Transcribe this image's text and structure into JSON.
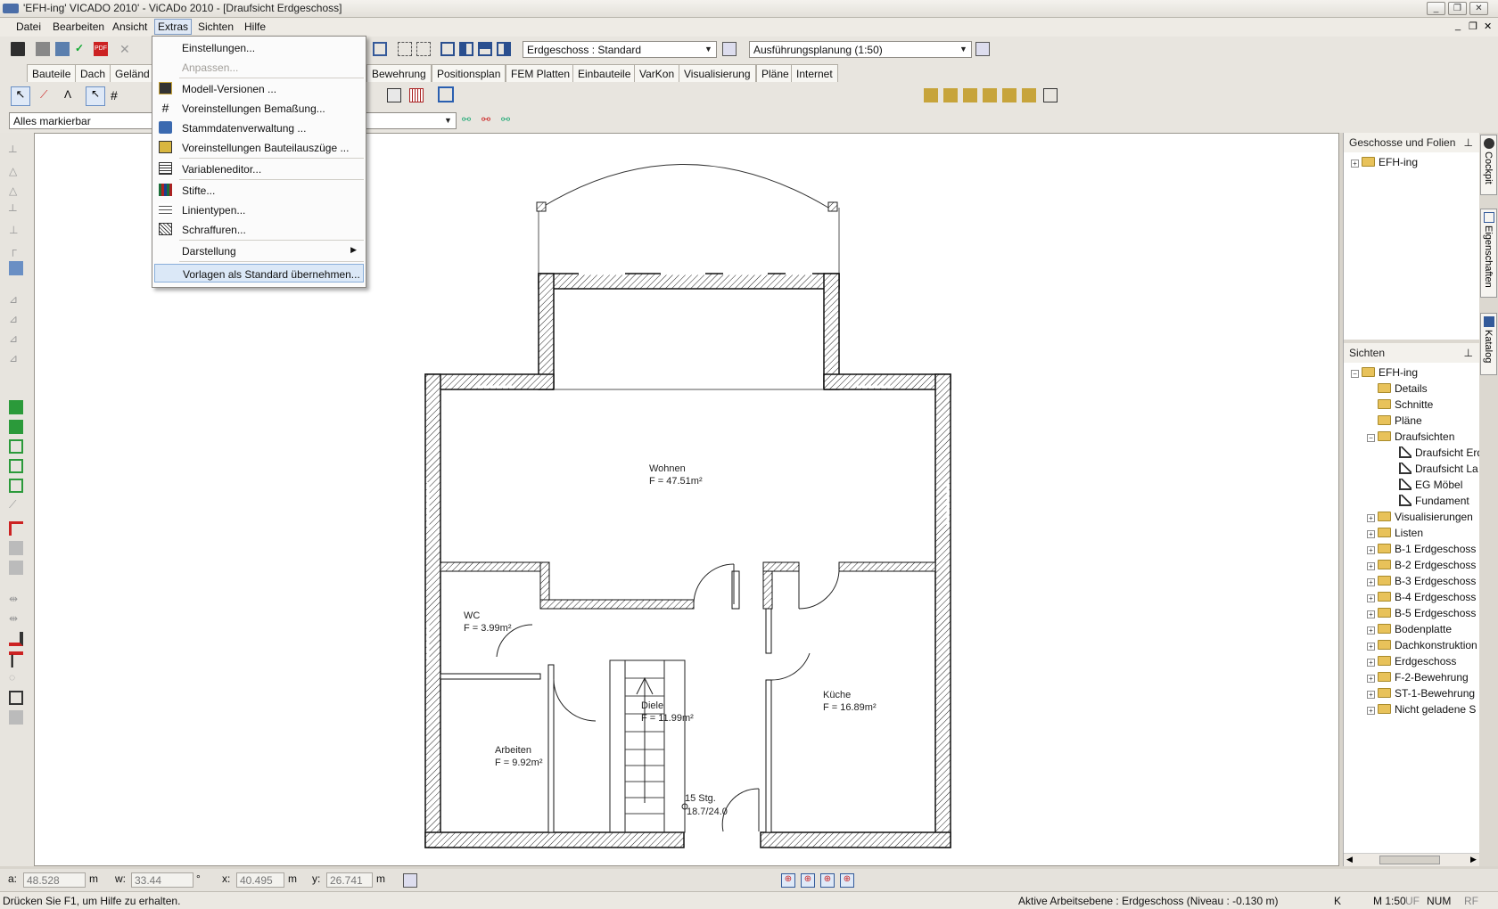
{
  "window": {
    "title": "'EFH-ing' VICADO 2010' - ViCADo 2010 - [Draufsicht Erdgeschoss]"
  },
  "menubar": {
    "items": [
      "Datei",
      "Bearbeiten",
      "Ansicht",
      "Extras",
      "Sichten",
      "Hilfe"
    ],
    "active": "Extras"
  },
  "toolbar": {
    "floor_combo": "Erdgeschoss : Standard",
    "plan_combo": "Ausführungsplanung (1:50)",
    "select_combo": "Alles markierbar"
  },
  "tabs": [
    "Bauteile",
    "Dach",
    "Geländ",
    "Bewehrung",
    "Positionsplan",
    "FEM Platten",
    "Einbauteile",
    "VarKon",
    "Visualisierung",
    "Pläne",
    "Internet"
  ],
  "extras_menu": {
    "items": [
      {
        "label": "Einstellungen...",
        "disabled": false
      },
      {
        "label": "Anpassen...",
        "disabled": true
      },
      {
        "label": "Modell-Versionen ...",
        "disabled": false
      },
      {
        "label": "Voreinstellungen Bemaßung...",
        "disabled": false
      },
      {
        "label": "Stammdatenverwaltung ...",
        "disabled": false
      },
      {
        "label": "Voreinstellungen Bauteilauszüge ...",
        "disabled": false
      },
      {
        "label": "Variableneditor...",
        "disabled": false
      },
      {
        "label": "Stifte...",
        "disabled": false
      },
      {
        "label": "Linientypen...",
        "disabled": false
      },
      {
        "label": "Schraffuren...",
        "disabled": false
      },
      {
        "label": "Darstellung",
        "disabled": false,
        "submenu": true
      },
      {
        "label": "Vorlagen als Standard übernehmen...",
        "disabled": false,
        "highlighted": true
      }
    ]
  },
  "floorplan": {
    "rooms": [
      {
        "name": "Wohnen",
        "area": "F = 47.51m²"
      },
      {
        "name": "WC",
        "area": "F = 3.99m²"
      },
      {
        "name": "Diele",
        "area": "F = 11.99m²"
      },
      {
        "name": "Küche",
        "area": "F = 16.89m²"
      },
      {
        "name": "Arbeiten",
        "area": "F = 9.92m²"
      }
    ],
    "stairs": {
      "steps": "15 Stg.",
      "ratio": "18.7/24.0"
    }
  },
  "panels": {
    "geschosse": {
      "title": "Geschosse und Folien",
      "root": "EFH-ing"
    },
    "sichten": {
      "title": "Sichten",
      "root": "EFH-ing",
      "items": [
        "Details",
        "Schnitte",
        "Pläne",
        "Draufsichten"
      ],
      "draufsichten": [
        "Draufsicht Erd",
        "Draufsicht La",
        "EG Möbel",
        "Fundament"
      ],
      "others": [
        "Visualisierungen",
        "Listen",
        "B-1 Erdgeschoss",
        "B-2 Erdgeschoss",
        "B-3 Erdgeschoss",
        "B-4 Erdgeschoss",
        "B-5 Erdgeschoss",
        "Bodenplatte",
        "Dachkonstruktion",
        "Erdgeschoss",
        "F-2-Bewehrung",
        "ST-1-Bewehrung",
        "Nicht geladene S"
      ]
    }
  },
  "side_tabs": [
    "Cockpit",
    "Eigenschaften",
    "Katalog"
  ],
  "coords": {
    "a_label": "a:",
    "a_val": "48.528",
    "a_unit": "m",
    "w_label": "w:",
    "w_val": "33.44",
    "w_unit": "°",
    "x_label": "x:",
    "x_val": "40.495",
    "x_unit": "m",
    "y_label": "y:",
    "y_val": "26.741",
    "y_unit": "m"
  },
  "status": {
    "help": "Drücken Sie F1, um Hilfe zu erhalten.",
    "plane": "Aktive Arbeitsebene : Erdgeschoss (Niveau : -0.130 m)",
    "k": "K",
    "scale": "M 1:50",
    "uf": "UF",
    "num": "NUM",
    "rf": "RF"
  }
}
